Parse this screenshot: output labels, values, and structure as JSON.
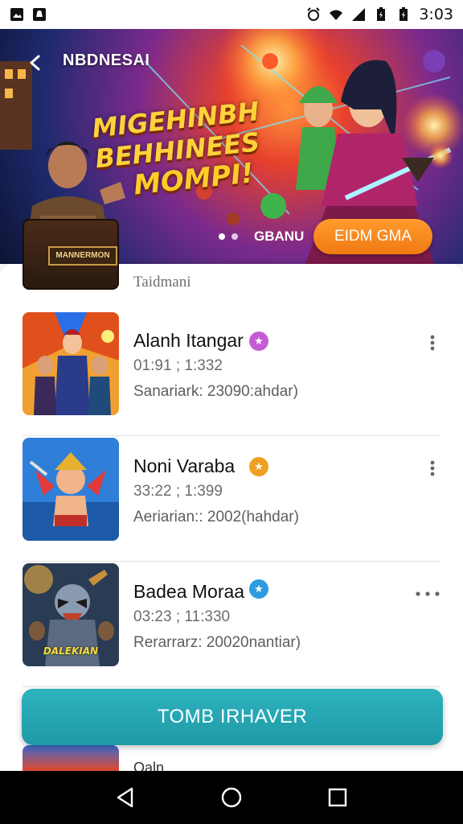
{
  "status_bar": {
    "time": "3:03",
    "icons": [
      "photo-icon",
      "notification-icon",
      "alarm-icon",
      "wifi-icon",
      "signal-icon",
      "battery-icon",
      "battery-icon"
    ]
  },
  "banner": {
    "title": "NBDNESAI",
    "headline": [
      "MIGEHINBH",
      "BEHHINEES",
      "MOMPI!"
    ],
    "caption": "GBANU",
    "cta_label": "EIDM GMA",
    "peek_sign": "MANNERMON",
    "colors": {
      "cta": "#f28a1c"
    }
  },
  "list": {
    "section_label": "Taidmani",
    "items": [
      {
        "title": "Alanh Itangar",
        "time": "01:91 ; 1:332",
        "meta": "Sanariark: 23090:ahdar)",
        "badge_color": "#c65bd6",
        "badge_icon": "star-badge-icon",
        "more_icon": "more-vertical-icon"
      },
      {
        "title": "Noni Varaba",
        "time": "33:22 ; 1:399",
        "meta": "Aeriarian:: 2002(hahdar)",
        "badge_color": "#f0a020",
        "badge_icon": "star-badge-icon",
        "more_icon": "more-vertical-icon"
      },
      {
        "title": "Badea Moraa",
        "time": "03:23 ; 11:330",
        "meta": "Rerarrarz: 20020nantiar)",
        "badge_color": "#2e9be0",
        "badge_icon": "star-badge-icon",
        "more_icon": "more-horizontal-icon",
        "thumb_text": "DALEKIAN"
      }
    ],
    "peek_text": "Oaln"
  },
  "primary_button": {
    "label": "TOMB IRHAVER",
    "color": "#24a7b3"
  },
  "nav_bar": {
    "icons": [
      "back-triangle-icon",
      "home-circle-icon",
      "recents-square-icon"
    ]
  }
}
